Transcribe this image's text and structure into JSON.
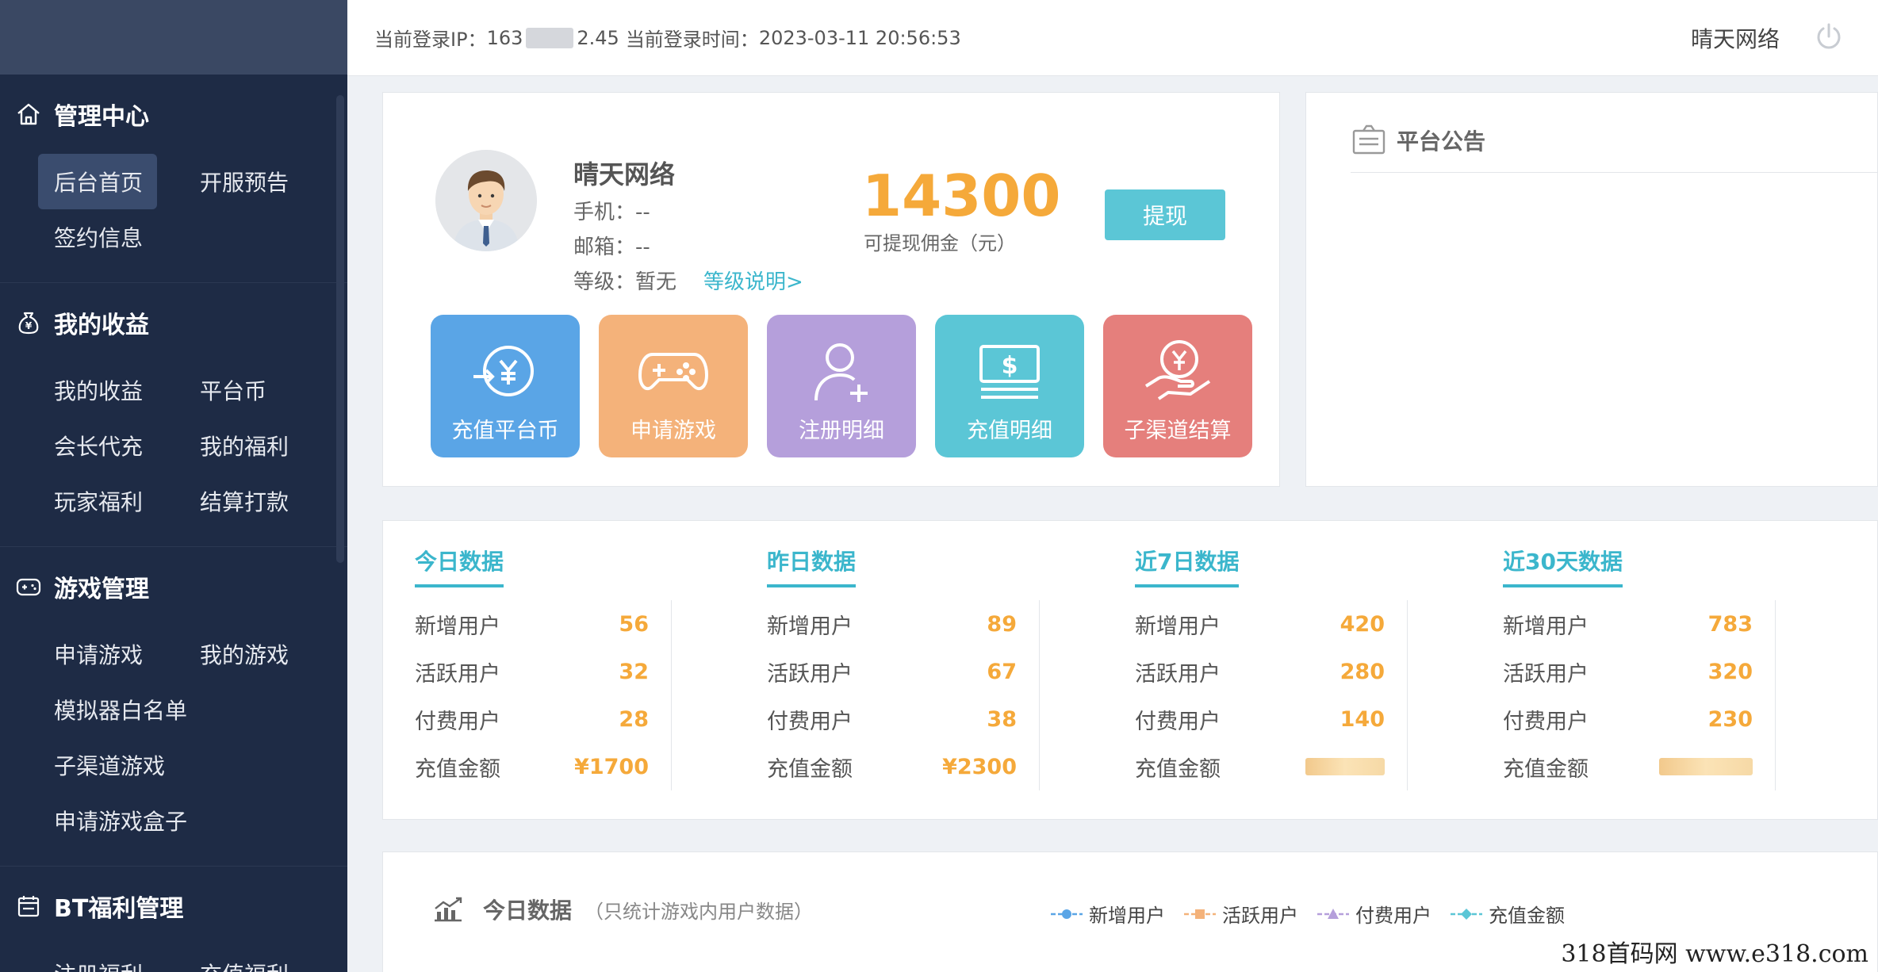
{
  "header": {
    "login_ip_label": "当前登录IP：",
    "login_ip_start": "163",
    "login_ip_end": "2.45",
    "login_time_label": "当前登录时间：",
    "login_time": "2023-03-11 20:56:53",
    "user_name": "晴天网络"
  },
  "sidebar": {
    "sections": [
      {
        "title": "管理中心",
        "icon": "home-icon",
        "items": [
          "后台首页",
          "开服预告",
          "签约信息"
        ]
      },
      {
        "title": "我的收益",
        "icon": "money-bag-icon",
        "items": [
          "我的收益",
          "平台币",
          "会长代充",
          "我的福利",
          "玩家福利",
          "结算打款"
        ]
      },
      {
        "title": "游戏管理",
        "icon": "gamepad-icon",
        "items": [
          "申请游戏",
          "我的游戏",
          "模拟器白名单",
          "子渠道游戏",
          "申请游戏盒子"
        ]
      },
      {
        "title": "BT福利管理",
        "icon": "calendar-icon",
        "items": [
          "注册福利",
          "充值福利"
        ]
      }
    ]
  },
  "profile": {
    "name": "晴天网络",
    "phone": "手机：--",
    "email": "邮箱：--",
    "level": "等级：暂无",
    "level_link": "等级说明>",
    "amount": "14300",
    "amount_label": "可提现佣金（元）",
    "withdraw_label": "提现",
    "tiles": [
      {
        "label": "充值平台币",
        "color": "#5aa5e6",
        "icon": "yen-transfer-icon"
      },
      {
        "label": "申请游戏",
        "color": "#f4b27a",
        "icon": "gamepad-icon"
      },
      {
        "label": "注册明细",
        "color": "#b59fdb",
        "icon": "add-user-icon"
      },
      {
        "label": "充值明细",
        "color": "#5bc6d6",
        "icon": "money-bill-icon"
      },
      {
        "label": "子渠道结算",
        "color": "#e57f7c",
        "icon": "yen-hand-icon"
      }
    ]
  },
  "notice": {
    "title": "平台公告"
  },
  "stats": [
    {
      "title": "今日数据",
      "rows": [
        [
          "新增用户",
          "56"
        ],
        [
          "活跃用户",
          "32"
        ],
        [
          "付费用户",
          "28"
        ],
        [
          "充值金额",
          "¥1700"
        ]
      ]
    },
    {
      "title": "昨日数据",
      "rows": [
        [
          "新增用户",
          "89"
        ],
        [
          "活跃用户",
          "67"
        ],
        [
          "付费用户",
          "38"
        ],
        [
          "充值金额",
          "¥2300"
        ]
      ]
    },
    {
      "title": "近7日数据",
      "rows": [
        [
          "新增用户",
          "420"
        ],
        [
          "活跃用户",
          "280"
        ],
        [
          "付费用户",
          "140"
        ],
        [
          "充值金额",
          ""
        ]
      ]
    },
    {
      "title": "近30天数据",
      "rows": [
        [
          "新增用户",
          "783"
        ],
        [
          "活跃用户",
          "320"
        ],
        [
          "付费用户",
          "230"
        ],
        [
          "充值金额",
          ""
        ]
      ]
    }
  ],
  "chart": {
    "title": "今日数据",
    "subtitle": "（只统计游戏内用户数据）",
    "legend": [
      {
        "name": "新增用户",
        "color": "#5aa5e6"
      },
      {
        "name": "活跃用户",
        "color": "#f4b27a"
      },
      {
        "name": "付费用户",
        "color": "#b59fdb"
      },
      {
        "name": "充值金额",
        "color": "#5bc6d6"
      }
    ]
  },
  "watermark": "318首码网  www.e318.com"
}
